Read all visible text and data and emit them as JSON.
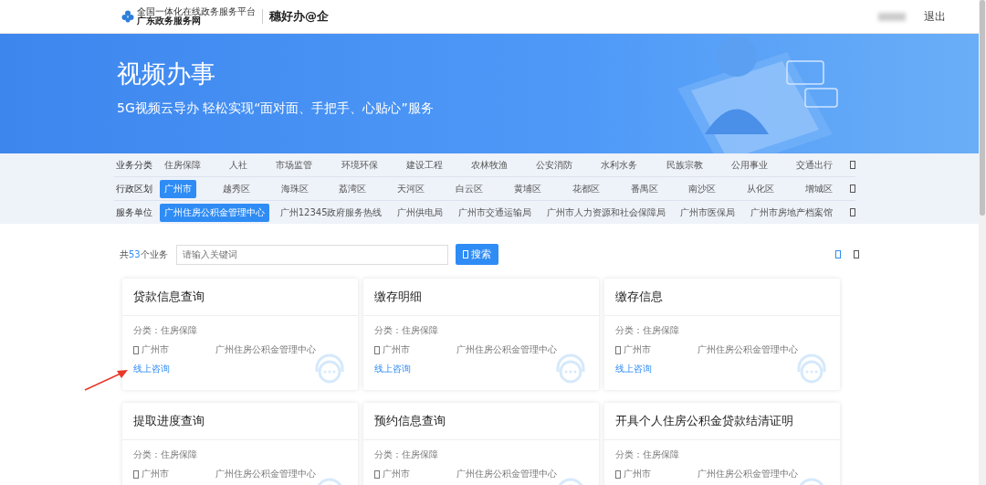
{
  "header": {
    "logo_tagline": "全国一体化在线政务服务平台",
    "logo_name": "广东政务服务网",
    "app_name": "穗好办@企",
    "logout": "退出"
  },
  "banner": {
    "title": "视频办事",
    "subtitle": "5G视频云导办 轻松实现“面对面、手把手、心贴心”服务"
  },
  "filters": [
    {
      "label": "业务分类",
      "options": [
        {
          "text": "住房保障",
          "selected": false
        },
        {
          "text": "人社",
          "selected": false
        },
        {
          "text": "市场监管",
          "selected": false
        },
        {
          "text": "环境环保",
          "selected": false
        },
        {
          "text": "建设工程",
          "selected": false
        },
        {
          "text": "农林牧渔",
          "selected": false
        },
        {
          "text": "公安消防",
          "selected": false
        },
        {
          "text": "水利水务",
          "selected": false
        },
        {
          "text": "民族宗教",
          "selected": false
        },
        {
          "text": "公用事业",
          "selected": false
        },
        {
          "text": "交通出行",
          "selected": false
        }
      ]
    },
    {
      "label": "行政区划",
      "options": [
        {
          "text": "广州市",
          "selected": true
        },
        {
          "text": "越秀区",
          "selected": false
        },
        {
          "text": "海珠区",
          "selected": false
        },
        {
          "text": "荔湾区",
          "selected": false
        },
        {
          "text": "天河区",
          "selected": false
        },
        {
          "text": "白云区",
          "selected": false
        },
        {
          "text": "黄埔区",
          "selected": false
        },
        {
          "text": "花都区",
          "selected": false
        },
        {
          "text": "番禺区",
          "selected": false
        },
        {
          "text": "南沙区",
          "selected": false
        },
        {
          "text": "从化区",
          "selected": false
        },
        {
          "text": "增城区",
          "selected": false
        }
      ]
    },
    {
      "label": "服务单位",
      "options": [
        {
          "text": "广州住房公积金管理中心",
          "selected": true
        },
        {
          "text": "广州12345政府服务热线",
          "selected": false
        },
        {
          "text": "广州供电局",
          "selected": false
        },
        {
          "text": "广州市交通运输局",
          "selected": false
        },
        {
          "text": "广州市人力资源和社会保障局",
          "selected": false
        },
        {
          "text": "广州市医保局",
          "selected": false
        },
        {
          "text": "广州市房地产档案馆",
          "selected": false
        }
      ]
    }
  ],
  "search": {
    "count_prefix": "共",
    "count": "53",
    "count_suffix": "个业务",
    "placeholder": "请输入关键词",
    "button": "搜索"
  },
  "cards": [
    {
      "title": "贷款信息查询",
      "category": "分类：住房保障",
      "city": "广州市",
      "org": "广州住房公积金管理中心",
      "link": "线上咨询"
    },
    {
      "title": "缴存明细",
      "category": "分类：住房保障",
      "city": "广州市",
      "org": "广州住房公积金管理中心",
      "link": "线上咨询"
    },
    {
      "title": "缴存信息",
      "category": "分类：住房保障",
      "city": "广州市",
      "org": "广州住房公积金管理中心",
      "link": "线上咨询"
    },
    {
      "title": "提取进度查询",
      "category": "分类：住房保障",
      "city": "广州市",
      "org": "广州住房公积金管理中心"
    },
    {
      "title": "预约信息查询",
      "category": "分类：住房保障",
      "city": "广州市",
      "org": "广州住房公积金管理中心"
    },
    {
      "title": "开具个人住房公积金贷款结清证明",
      "category": "分类：住房保障",
      "city": "广州市",
      "org": "广州住房公积金管理中心"
    }
  ]
}
